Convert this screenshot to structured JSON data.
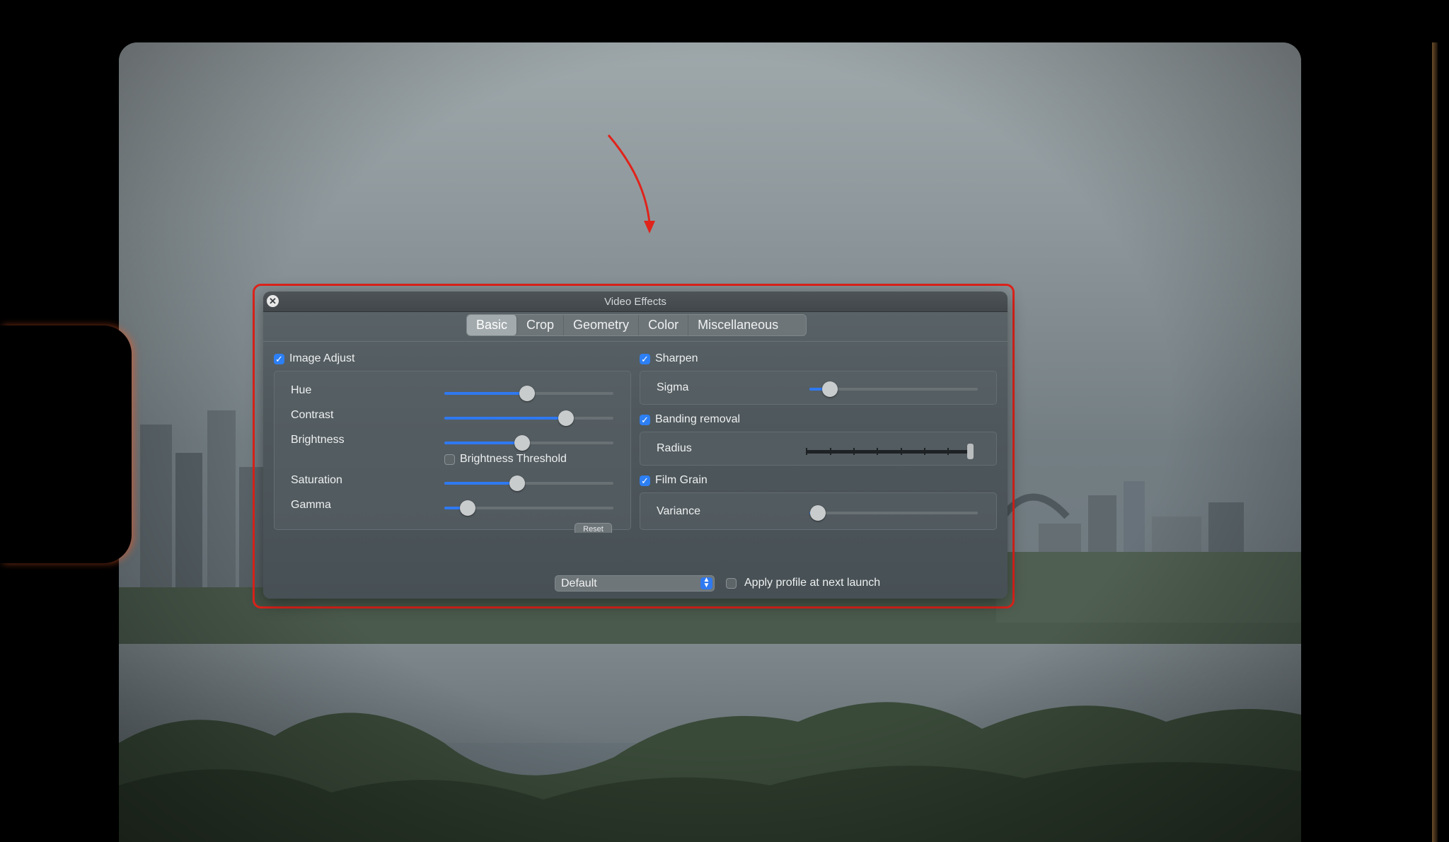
{
  "dialog": {
    "title": "Video Effects",
    "close_icon": "close-icon"
  },
  "tabs": [
    {
      "label": "Basic",
      "active": true
    },
    {
      "label": "Crop",
      "active": false
    },
    {
      "label": "Geometry",
      "active": false
    },
    {
      "label": "Color",
      "active": false
    },
    {
      "label": "Miscellaneous",
      "active": false
    }
  ],
  "image_adjust": {
    "label": "Image Adjust",
    "checked": true,
    "sliders": [
      {
        "label": "Hue",
        "value": 0.49
      },
      {
        "label": "Contrast",
        "value": 0.72
      },
      {
        "label": "Brightness",
        "value": 0.46
      },
      {
        "label": "Saturation",
        "value": 0.43
      },
      {
        "label": "Gamma",
        "value": 0.14
      }
    ],
    "brightness_threshold": {
      "label": "Brightness Threshold",
      "checked": false
    },
    "reset_label": "Reset"
  },
  "sharpen": {
    "label": "Sharpen",
    "checked": true,
    "param_label": "Sigma",
    "value": 0.12
  },
  "banding_removal": {
    "label": "Banding removal",
    "checked": true,
    "param_label": "Radius",
    "value": 1.0
  },
  "film_grain": {
    "label": "Film Grain",
    "checked": true,
    "param_label": "Variance",
    "value": 0.05
  },
  "footer": {
    "profile_value": "Default",
    "apply_label": "Apply profile at next launch",
    "apply_checked": false
  },
  "colors": {
    "accent": "#2f79f1",
    "highlight": "#e0231b"
  }
}
